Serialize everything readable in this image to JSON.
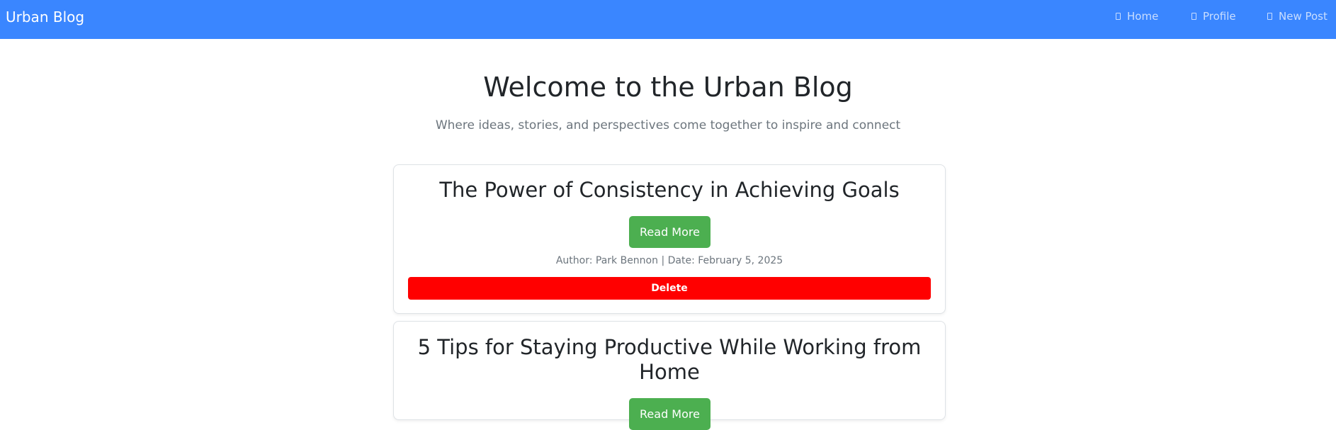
{
  "navbar": {
    "brand": "Urban Blog",
    "links": [
      {
        "label": "Home",
        "icon": "home-icon"
      },
      {
        "label": "Profile",
        "icon": "profile-icon"
      },
      {
        "label": "New Post",
        "icon": "new-post-icon"
      }
    ],
    "background_color": "#3a86ff"
  },
  "hero": {
    "title": "Welcome to the Urban Blog",
    "subtitle": "Where ideas, stories, and perspectives come together to inspire and connect"
  },
  "posts": [
    {
      "title": "The Power of Consistency in Achieving Goals",
      "read_more_label": "Read More",
      "meta": "Author: Park Bennon | Date: February 5, 2025",
      "delete_label": "Delete"
    },
    {
      "title": "5 Tips for Staying Productive While Working from Home",
      "read_more_label": "Read More"
    }
  ],
  "colors": {
    "read_more": "#4caf50",
    "delete": "#ff0000"
  }
}
